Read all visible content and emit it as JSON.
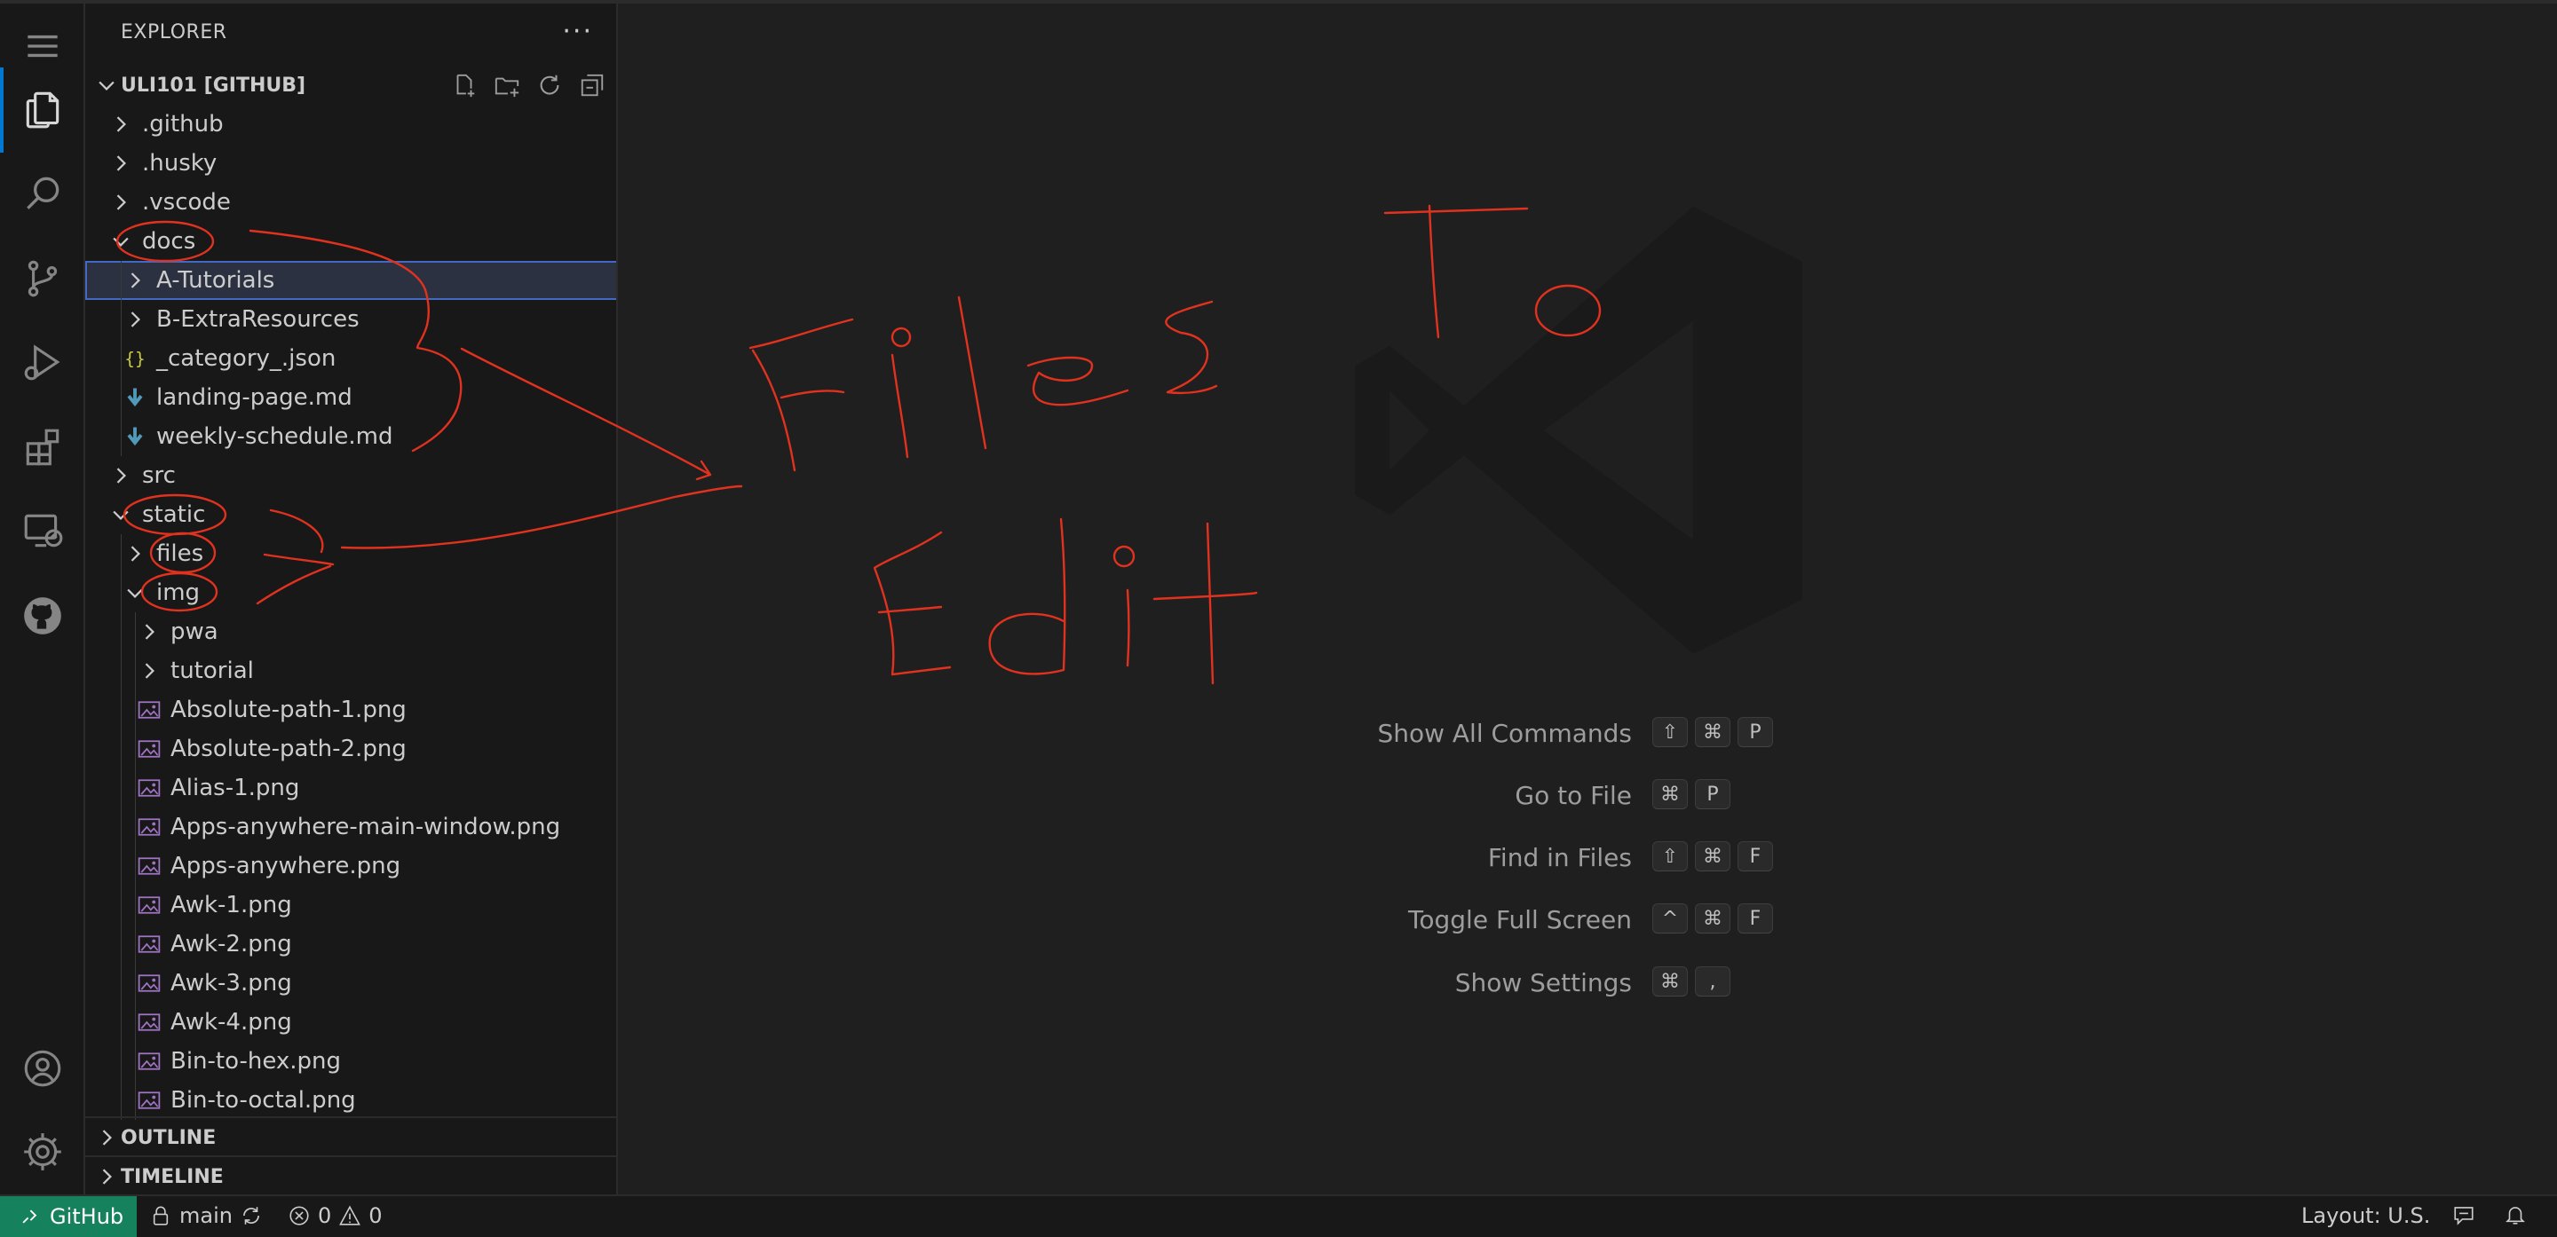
{
  "activity_bar": {
    "items": [
      "menu-icon",
      "files-icon",
      "search-icon",
      "source-control-icon",
      "run-debug-icon",
      "extensions-icon",
      "remote-explorer-icon",
      "github-icon",
      "account-icon",
      "settings-gear-icon"
    ],
    "accent_color": "#0078d4"
  },
  "sidebar": {
    "title": "EXPLORER",
    "more_actions": "···",
    "workspace_label": "ULI101 [GITHUB]",
    "workspace_actions": [
      "new-file-icon",
      "new-folder-icon",
      "refresh-icon",
      "collapse-all-icon"
    ],
    "tree": [
      {
        "label": ".github",
        "type": "folder",
        "expanded": false
      },
      {
        "label": ".husky",
        "type": "folder",
        "expanded": false
      },
      {
        "label": ".vscode",
        "type": "folder",
        "expanded": false
      },
      {
        "label": "docs",
        "type": "folder",
        "expanded": true
      },
      {
        "label": "A-Tutorials",
        "type": "folder",
        "expanded": false,
        "selected": true
      },
      {
        "label": "B-ExtraResources",
        "type": "folder",
        "expanded": false
      },
      {
        "label": "_category_.json",
        "type": "json"
      },
      {
        "label": "landing-page.md",
        "type": "markdown"
      },
      {
        "label": "weekly-schedule.md",
        "type": "markdown"
      },
      {
        "label": "src",
        "type": "folder",
        "expanded": false
      },
      {
        "label": "static",
        "type": "folder",
        "expanded": true
      },
      {
        "label": "files",
        "type": "folder",
        "expanded": false
      },
      {
        "label": "img",
        "type": "folder",
        "expanded": true
      },
      {
        "label": "pwa",
        "type": "folder",
        "expanded": false
      },
      {
        "label": "tutorial",
        "type": "folder",
        "expanded": false
      },
      {
        "label": "Absolute-path-1.png",
        "type": "image"
      },
      {
        "label": "Absolute-path-2.png",
        "type": "image"
      },
      {
        "label": "Alias-1.png",
        "type": "image"
      },
      {
        "label": "Apps-anywhere-main-window.png",
        "type": "image"
      },
      {
        "label": "Apps-anywhere.png",
        "type": "image"
      },
      {
        "label": "Awk-1.png",
        "type": "image"
      },
      {
        "label": "Awk-2.png",
        "type": "image"
      },
      {
        "label": "Awk-3.png",
        "type": "image"
      },
      {
        "label": "Awk-4.png",
        "type": "image"
      },
      {
        "label": "Bin-to-hex.png",
        "type": "image"
      },
      {
        "label": "Bin-to-octal.png",
        "type": "image"
      }
    ],
    "outline_label": "OUTLINE",
    "timeline_label": "TIMELINE"
  },
  "editor": {
    "watermark": "vscode-logo-icon",
    "shortcuts": [
      {
        "label": "Show All Commands",
        "keys": [
          "⇧",
          "⌘",
          "P"
        ]
      },
      {
        "label": "Go to File",
        "keys": [
          "⌘",
          "P"
        ]
      },
      {
        "label": "Find in Files",
        "keys": [
          "⇧",
          "⌘",
          "F"
        ]
      },
      {
        "label": "Toggle Full Screen",
        "keys": [
          "^",
          "⌘",
          "F"
        ]
      },
      {
        "label": "Show Settings",
        "keys": [
          "⌘",
          ","
        ]
      }
    ]
  },
  "annotation": {
    "color": "#e0321e"
  },
  "status_bar": {
    "remote_label": "GitHub",
    "remote_color": "#16825d",
    "branch": "main",
    "errors": "0",
    "warnings": "0",
    "layout": "Layout: U.S."
  }
}
